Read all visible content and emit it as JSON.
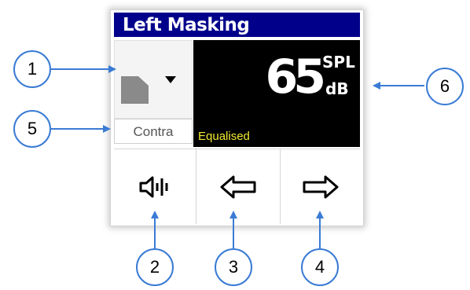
{
  "panel": {
    "title": "Left Masking",
    "channel_selector": {
      "icon": "ear-icon",
      "dropdown_icon": "caret-down-icon"
    },
    "mode_label": "Contra",
    "level": {
      "value": "65",
      "unit_top": "SPL",
      "unit_bottom": "dB",
      "status": "Equalised"
    },
    "buttons": [
      {
        "name": "tone-button",
        "icon": "speaker-tone-icon"
      },
      {
        "name": "decrease-button",
        "icon": "arrow-left-icon"
      },
      {
        "name": "increase-button",
        "icon": "arrow-right-icon"
      }
    ]
  },
  "callouts": [
    "1",
    "2",
    "3",
    "4",
    "5",
    "6"
  ],
  "colors": {
    "title_bar": "#00008b",
    "status_text": "#f2e832",
    "callout_ring": "#3a7bd5"
  }
}
